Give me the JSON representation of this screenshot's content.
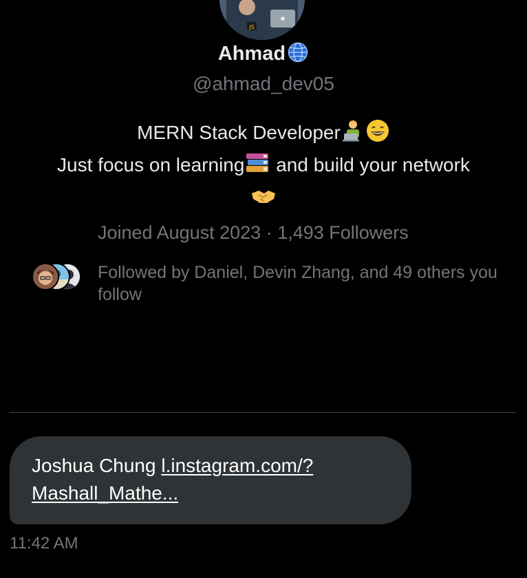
{
  "profile": {
    "name": "Ahmad",
    "name_badge_icon": "globe-icon",
    "handle": "@ahmad_dev05",
    "bio_line1": "MERN Stack Developer",
    "bio_line1_emojis": [
      "technologist-icon",
      "grinning-face-icon"
    ],
    "bio_line2_a": "Just focus on learning",
    "bio_line2_emoji": "books-icon",
    "bio_line2_b": " and build your network",
    "bio_line3_emoji": "handshake-icon",
    "meta": "Joined August 2023 · 1,493 Followers",
    "followed_by": "Followed by Daniel, Devin Zhang, and 49 others you follow"
  },
  "message": {
    "sender_text": "Joshua Chung ",
    "link_text": "l.instagram.com/?Mashall_Mathe...",
    "link_line1": "l.instagram.com/?",
    "link_line2": "Mashall_Mathe...",
    "timestamp": "11:42 AM"
  },
  "colors": {
    "background": "#000000",
    "primary_text": "#e7e9ea",
    "secondary_text": "#71767b",
    "bubble": "#2f3336",
    "divider": "#3d4043"
  }
}
